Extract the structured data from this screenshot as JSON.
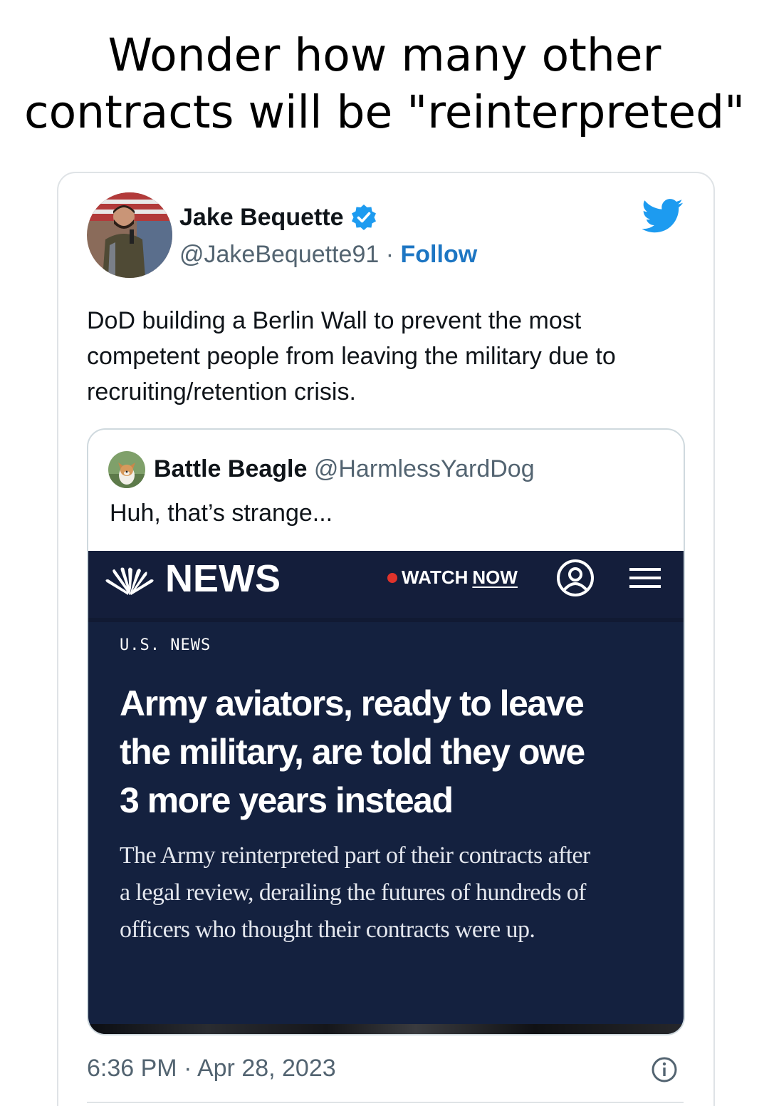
{
  "caption": {
    "line1": "Wonder how many other",
    "line2": "contracts will be \"reinterpreted\""
  },
  "tweet": {
    "author_name": "Jake Bequette",
    "author_handle": "@JakeBequette91",
    "separator": "·",
    "follow_label": "Follow",
    "text_lines": [
      "DoD building a Berlin Wall to prevent the most",
      "competent people from leaving the military due to",
      "recruiting/retention crisis."
    ],
    "timestamp": "6:36 PM · Apr 28, 2023"
  },
  "quote": {
    "name": "Battle Beagle",
    "handle": "@HarmlessYardDog",
    "text": "Huh, that’s strange..."
  },
  "news": {
    "logo_text": "NEWS",
    "watch_label": "WATCH",
    "now_label": "NOW",
    "section": "U.S. NEWS",
    "headline_lines": [
      "Army aviators, ready to leave",
      "the military, are told they owe",
      "3 more years instead"
    ],
    "dek_lines": [
      "The Army reinterpreted part of their contracts after",
      "a legal review, derailing the futures of hundreds of",
      "officers who thought their contracts were up."
    ]
  },
  "colors": {
    "link_blue": "#1d76c3",
    "twitter_blue": "#1d9bf0",
    "news_navy": "#14213f",
    "live_dot": "#e0332b"
  },
  "icons": {
    "verified": "verified-badge-icon",
    "twitter": "twitter-bird-icon",
    "user": "user-account-icon",
    "menu": "hamburger-menu-icon",
    "info": "info-icon",
    "nbc": "nbc-peacock-logo"
  }
}
